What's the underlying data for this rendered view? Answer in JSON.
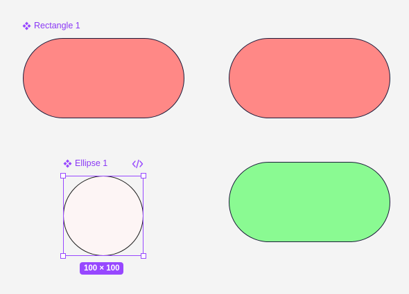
{
  "colors": {
    "canvas_bg": "#f4f4f4",
    "accent": "#9747ff",
    "accent_text": "#8a38f5",
    "shape_stroke": "#1b1b3a",
    "red_fill": "#ff8886",
    "green_fill": "#8afa92",
    "circle_fill": "#fdf5f5",
    "circle_stroke": "#1a1a1a"
  },
  "components": {
    "rectangle": {
      "label": "Rectangle 1",
      "icon": "component-diamond-icon"
    },
    "ellipse": {
      "label": "Ellipse 1",
      "icon": "component-diamond-icon",
      "dev_icon": "code-brackets-icon"
    }
  },
  "selection": {
    "size_label": "100 × 100"
  }
}
